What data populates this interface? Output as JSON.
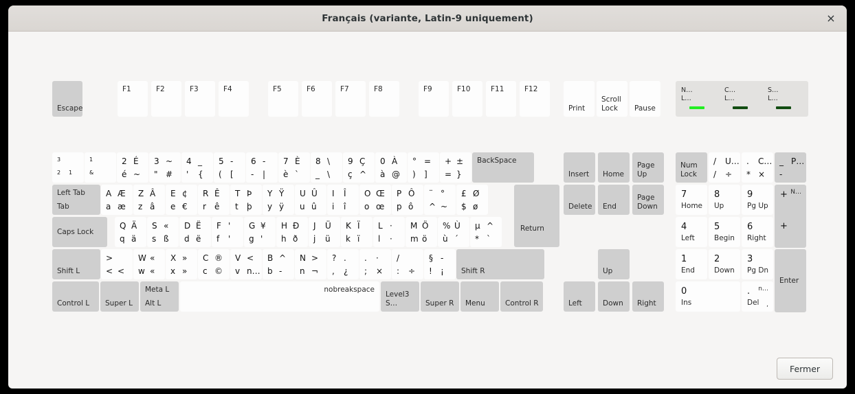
{
  "window": {
    "title": "Français (variante, Latin-9 uniquement)",
    "close_icon": "×",
    "close_button_label": "Fermer"
  },
  "colors": {
    "key_face": "#fdfdfd",
    "key_modifier": "#cfcfcf",
    "background": "#f6f5f4",
    "titlebar": "#dad6d2",
    "led_on": "#22ee22",
    "led_off": "#124d12"
  },
  "indicators": [
    {
      "name": "num-lock",
      "line1": "N…",
      "line2": "L…",
      "state": "on",
      "color": "#22ee22"
    },
    {
      "name": "caps-lock",
      "line1": "C…",
      "line2": "L…",
      "state": "off",
      "color": "#124d12"
    },
    {
      "name": "scroll-lock",
      "line1": "S…",
      "line2": "L…",
      "state": "off",
      "color": "#124d12"
    }
  ],
  "function_row": {
    "escape": "Escape",
    "fkeys": [
      "F1",
      "F2",
      "F3",
      "F4",
      "F5",
      "F6",
      "F7",
      "F8",
      "F9",
      "F10",
      "F11",
      "F12"
    ],
    "system": [
      "Print",
      "Scroll\nLock",
      "Pause"
    ]
  },
  "number_row": [
    {
      "tl": "3",
      "tr": "",
      "bl": "2",
      "br": "1",
      "small": true
    },
    {
      "tl": "1",
      "tr": "",
      "bl": "&",
      "br": "",
      "small": true
    },
    {
      "tl": "2",
      "tr": "É",
      "bl": "é",
      "br": "~"
    },
    {
      "tl": "3",
      "tr": "~",
      "bl": "\"",
      "br": "#"
    },
    {
      "tl": "4",
      "tr": "_",
      "bl": "'",
      "br": "{"
    },
    {
      "tl": "5",
      "tr": "-",
      "bl": "(",
      "br": "["
    },
    {
      "tl": "6",
      "tr": "-",
      "bl": "-",
      "br": "|"
    },
    {
      "tl": "7",
      "tr": "È",
      "bl": "è",
      "br": "`"
    },
    {
      "tl": "8",
      "tr": "\\",
      "bl": "_",
      "br": "\\"
    },
    {
      "tl": "9",
      "tr": "Ç",
      "bl": "ç",
      "br": "^"
    },
    {
      "tl": "0",
      "tr": "À",
      "bl": "à",
      "br": "@"
    },
    {
      "tl": "°",
      "tr": "=",
      "bl": ")",
      "br": "]"
    },
    {
      "tl": "+",
      "tr": "±",
      "bl": "=",
      "br": "}"
    }
  ],
  "backspace_label": "BackSpace",
  "tab_key": {
    "top": "Left Tab",
    "bottom": "Tab"
  },
  "top_row": [
    {
      "tl": "A",
      "tr": "Æ",
      "bl": "a",
      "br": "æ"
    },
    {
      "tl": "Z",
      "tr": "Â",
      "bl": "z",
      "br": "â"
    },
    {
      "tl": "E",
      "tr": "¢",
      "bl": "e",
      "br": "€"
    },
    {
      "tl": "R",
      "tr": "Ê",
      "bl": "r",
      "br": "ê"
    },
    {
      "tl": "T",
      "tr": "Þ",
      "bl": "t",
      "br": "þ"
    },
    {
      "tl": "Y",
      "tr": "Ÿ",
      "bl": "y",
      "br": "ÿ"
    },
    {
      "tl": "U",
      "tr": "Û",
      "bl": "u",
      "br": "û"
    },
    {
      "tl": "I",
      "tr": "Î",
      "bl": "i",
      "br": "î"
    },
    {
      "tl": "O",
      "tr": "Œ",
      "bl": "o",
      "br": "œ"
    },
    {
      "tl": "P",
      "tr": "Ô",
      "bl": "p",
      "br": "ô"
    },
    {
      "tl": "¨",
      "tr": "°",
      "bl": "^",
      "br": "~"
    },
    {
      "tl": "£",
      "tr": "Ø",
      "bl": "$",
      "br": "ø"
    }
  ],
  "caps_lock_label": "Caps Lock",
  "home_row": [
    {
      "tl": "Q",
      "tr": "Ä",
      "bl": "q",
      "br": "ä"
    },
    {
      "tl": "S",
      "tr": "«",
      "bl": "s",
      "br": "ß"
    },
    {
      "tl": "D",
      "tr": "Ë",
      "bl": "d",
      "br": "ë"
    },
    {
      "tl": "F",
      "tr": "'",
      "bl": "f",
      "br": "'"
    },
    {
      "tl": "G",
      "tr": "¥",
      "bl": "g",
      "br": "'"
    },
    {
      "tl": "H",
      "tr": "Ð",
      "bl": "h",
      "br": "ð"
    },
    {
      "tl": "J",
      "tr": "Ü",
      "bl": "j",
      "br": "ü"
    },
    {
      "tl": "K",
      "tr": "Ï",
      "bl": "k",
      "br": "ï"
    },
    {
      "tl": "L",
      "tr": "·",
      "bl": "l",
      "br": "·"
    },
    {
      "tl": "M",
      "tr": "Ö",
      "bl": "m",
      "br": "ö"
    },
    {
      "tl": "%",
      "tr": "Ù",
      "bl": "ù",
      "br": "´"
    },
    {
      "tl": "µ",
      "tr": "^",
      "bl": "*",
      "br": "`"
    }
  ],
  "return_label": "Return",
  "bottom_row": {
    "shift_left": "Shift L",
    "shift_right": "Shift R",
    "keys": [
      {
        "tl": ">",
        "tr": "",
        "bl": "<",
        "br": "<"
      },
      {
        "tl": "W",
        "tr": "«",
        "bl": "w",
        "br": "«"
      },
      {
        "tl": "X",
        "tr": "»",
        "bl": "x",
        "br": "»"
      },
      {
        "tl": "C",
        "tr": "®",
        "bl": "c",
        "br": "©"
      },
      {
        "tl": "V",
        "tr": "<",
        "bl": "v",
        "br": "n…"
      },
      {
        "tl": "B",
        "tr": "^",
        "bl": "b",
        "br": "-"
      },
      {
        "tl": "N",
        "tr": ">",
        "bl": "n",
        "br": "¬"
      },
      {
        "tl": "?",
        "tr": ".",
        "bl": ",",
        "br": "¿"
      },
      {
        "tl": ".",
        "tr": "·",
        "bl": ";",
        "br": "×"
      },
      {
        "tl": "/",
        "tr": "",
        "bl": ":",
        "br": "÷"
      },
      {
        "tl": "§",
        "tr": "-",
        "bl": "!",
        "br": "¡"
      }
    ]
  },
  "modifier_row": {
    "control_left": "Control L",
    "super_left": "Super L",
    "alt_left": {
      "top": "Meta L",
      "bottom": "Alt L"
    },
    "space": "nobreakspace",
    "level3": "Level3 S…",
    "super_right": "Super R",
    "menu": "Menu",
    "control_right": "Control R"
  },
  "nav_cluster": {
    "row1": [
      "Insert",
      "Home",
      "Page\nUp"
    ],
    "row2": [
      "Delete",
      "End",
      "Page\nDown"
    ],
    "arrows": {
      "up": "Up",
      "left": "Left",
      "down": "Down",
      "right": "Right"
    }
  },
  "numpad": {
    "num_lock": "Num\nLock",
    "divide": {
      "tl": "/",
      "tr": "U…",
      "bl": "/",
      "br": "÷"
    },
    "multiply": {
      "tl": ".",
      "tr": "C…",
      "bl": "*",
      "br": "×"
    },
    "minus": {
      "tl": "_",
      "tr": "P…",
      "bl": "-",
      "br": ""
    },
    "plus": {
      "tl": "+",
      "tr": "N…"
    },
    "plus2": {
      "tl": "+"
    },
    "enter": "Enter",
    "digits": [
      {
        "digit": "7",
        "name": "Home"
      },
      {
        "digit": "8",
        "name": "Up"
      },
      {
        "digit": "9",
        "name": "Pg Up"
      },
      {
        "digit": "4",
        "name": "Left"
      },
      {
        "digit": "5",
        "name": "Begin"
      },
      {
        "digit": "6",
        "name": "Right"
      },
      {
        "digit": "1",
        "name": "End"
      },
      {
        "digit": "2",
        "name": "Down"
      },
      {
        "digit": "3",
        "name": "Pg Dn"
      }
    ],
    "zero": {
      "digit": "0",
      "name": "Ins"
    },
    "decimal": {
      "digit": ".",
      "name": "Del",
      "tr": "n…",
      "br": ","
    }
  }
}
